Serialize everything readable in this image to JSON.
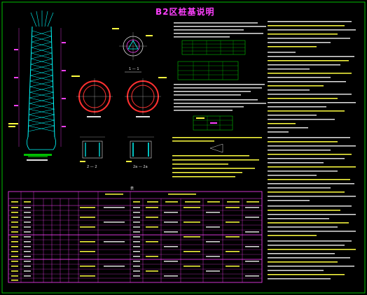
{
  "title": "B2区桩基说明",
  "section_labels": {
    "s11": "1 — 1",
    "s22": "2 — 2",
    "s2a": "2a — 2a",
    "table_title": "表"
  },
  "colors": {
    "frame": "#00c000",
    "text": "#e8e8e8",
    "heading": "#ff40ff",
    "pile": "#00ffff",
    "ring": "#ff3030",
    "table_grid": "#ff40ff",
    "note": "#ffff40"
  }
}
